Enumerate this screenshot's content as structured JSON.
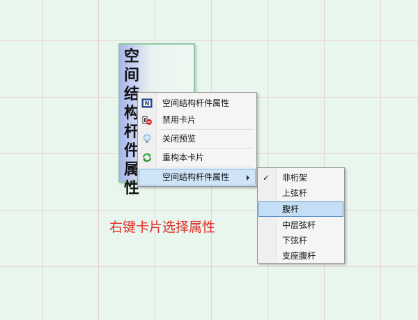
{
  "card": {
    "title": "空间结构杆件属性"
  },
  "context_menu": {
    "items": [
      {
        "label": "空间结构杆件属性",
        "icon": "n-document-icon"
      },
      {
        "label": "禁用卡片",
        "icon": "disable-card-icon"
      },
      {
        "label": "关闭预览",
        "icon": "bulb-icon"
      },
      {
        "label": "重构本卡片",
        "icon": "refresh-icon"
      },
      {
        "label": "空间结构杆件属性",
        "icon": "",
        "has_submenu": true
      }
    ]
  },
  "submenu": {
    "items": [
      {
        "label": "非桁架",
        "checked": true
      },
      {
        "label": "上弦杆"
      },
      {
        "label": "腹杆",
        "highlighted": true
      },
      {
        "label": "中层弦杆"
      },
      {
        "label": "下弦杆"
      },
      {
        "label": "支座腹杆"
      }
    ]
  },
  "caption": "右键卡片选择属性",
  "colors": {
    "background": "#e8f6ee",
    "grid": "#e8b4be",
    "card_border": "#8fc9a8",
    "highlight": "#cfe4f7",
    "caption": "#e0302a"
  }
}
